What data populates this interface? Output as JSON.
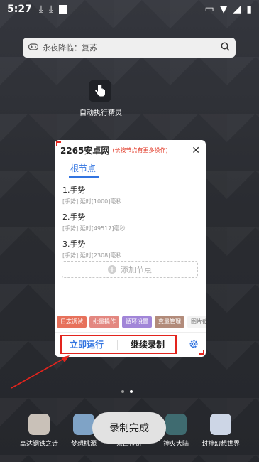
{
  "status": {
    "time": "5:27"
  },
  "search": {
    "text": "永夜降临：复苏"
  },
  "app": {
    "label": "自动执行精灵"
  },
  "dialog": {
    "title": "2265安卓网",
    "hint": "(长按节点有更多操作)",
    "close": "✕",
    "tab": "根节点",
    "nodes": [
      {
        "title": "1.手势",
        "detail": "[手势],延时[1000]毫秒"
      },
      {
        "title": "2.手势",
        "detail": "[手势],延时[49517]毫秒"
      },
      {
        "title": "3.手势",
        "detail": "[手势],延时[2308]毫秒"
      }
    ],
    "add_node": "添加节点",
    "tools": [
      {
        "label": "日志调试",
        "color": "#e7715b"
      },
      {
        "label": "批量操作",
        "color": "#e38780"
      },
      {
        "label": "循环设置",
        "color": "#a185d8"
      },
      {
        "label": "变量管理",
        "color": "#b28b7a"
      },
      {
        "label": "图片截",
        "color": "#f3f3f3"
      }
    ],
    "run": "立即运行",
    "record": "继续录制"
  },
  "toast": "录制完成",
  "dock": [
    {
      "label": "高达钢铁之诗",
      "color": "#c9c1b8"
    },
    {
      "label": "梦想桃源",
      "color": "#7fa3c6"
    },
    {
      "label": "东山传奇",
      "color": "#b8a176"
    },
    {
      "label": "神火大陆",
      "color": "#3f6b70"
    },
    {
      "label": "封神幻想世界",
      "color": "#cdd6e6"
    }
  ],
  "colors": {
    "highlight": "#e3241d",
    "accent": "#3274e0"
  }
}
